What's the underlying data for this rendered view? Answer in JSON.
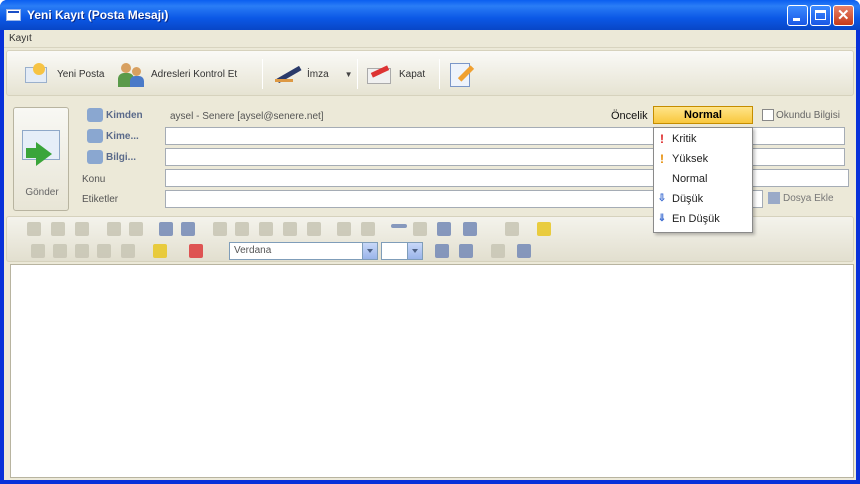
{
  "window": {
    "title": "Yeni Kayıt (Posta Mesajı)"
  },
  "menubar": {
    "items": [
      "Kayıt"
    ]
  },
  "toolbar": {
    "new_mail": "Yeni Posta",
    "check_addresses": "Adresleri Kontrol Et",
    "signature": "İmza",
    "close": "Kapat"
  },
  "header": {
    "send_label": "Gönder",
    "from_label": "Kimden",
    "from_value": "aysel - Senere [aysel@senere.net]",
    "to_label": "Kime...",
    "cc_label": "Bilgi...",
    "subject_label": "Konu",
    "tags_label": "Etiketler",
    "priority_label": "Öncelik",
    "priority_value": "Normal",
    "read_receipt_label": "Okundu Bilgisi",
    "attach_label": "Dosya Ekle"
  },
  "priority_options": [
    {
      "label": "Kritik",
      "icon": "exclamation-red-icon"
    },
    {
      "label": "Yüksek",
      "icon": "exclamation-orange-icon"
    },
    {
      "label": "Normal",
      "icon": ""
    },
    {
      "label": "Düşük",
      "icon": "arrow-down-blue-icon"
    },
    {
      "label": "En Düşük",
      "icon": "arrow-down-double-blue-icon"
    }
  ],
  "format": {
    "font": "Verdana",
    "size": ""
  },
  "colors": {
    "accent": "#f9c73d",
    "title_bar": "#0b58e6",
    "chrome": "#ece9d8"
  }
}
